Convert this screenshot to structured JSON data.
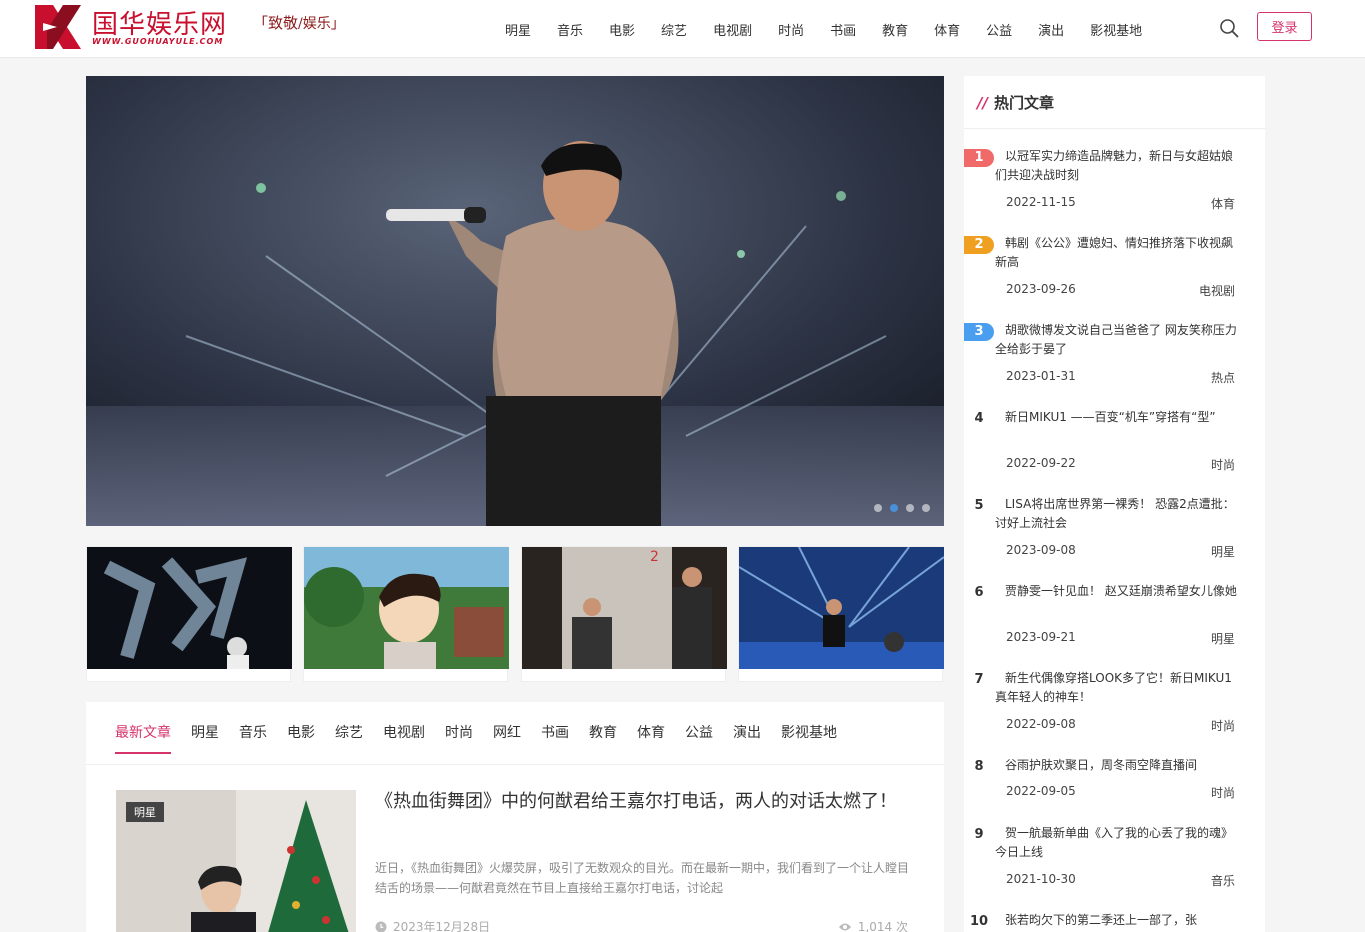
{
  "header": {
    "logo_cn": "国华娱乐网",
    "logo_en": "WWW.GUOHUAYULE.COM",
    "slogan_left": "「致敬",
    "slogan_right": "/娱乐」",
    "nav": [
      "明星",
      "音乐",
      "电影",
      "综艺",
      "电视剧",
      "时尚",
      "书画",
      "教育",
      "体育",
      "公益",
      "演出",
      "影视基地"
    ],
    "login_label": "登录",
    "brand_color": "#c8102e",
    "accent_color": "#d6336c"
  },
  "hero": {
    "dots_count": 4,
    "active_dot": 2
  },
  "latest": {
    "tabs": [
      "最新文章",
      "明星",
      "音乐",
      "电影",
      "综艺",
      "电视剧",
      "时尚",
      "网红",
      "书画",
      "教育",
      "体育",
      "公益",
      "演出",
      "影视基地"
    ],
    "active_tab": 0,
    "article": {
      "tag": "明星",
      "title": "《热血街舞团》中的何猷君给王嘉尔打电话，两人的对话太燃了！",
      "summary": "近日，《热血街舞团》火爆荧屏，吸引了无数观众的目光。而在最新一期中，我们看到了一个让人瞠目结舌的场景——何猷君竟然在节目上直接给王嘉尔打电话，讨论起",
      "date": "2023年12月28日",
      "views": "1,014 次"
    }
  },
  "sidebar": {
    "title": "热门文章",
    "items": [
      {
        "rank": "1",
        "title": "以冠军实力缔造品牌魅力，新日与女超姑娘们共迎决战时刻",
        "date": "2022-11-15",
        "cat": "体育"
      },
      {
        "rank": "2",
        "title": "韩剧《公公》遭媳妇、情妇推挤落下收视飙新高",
        "date": "2023-09-26",
        "cat": "电视剧"
      },
      {
        "rank": "3",
        "title": "胡歌微博发文说自己当爸爸了 网友笑称压力全给彭于晏了",
        "date": "2023-01-31",
        "cat": "热点"
      },
      {
        "rank": "4",
        "title": "新日MIKU1 ——百变“机车”穿搭有“型”",
        "date": "2022-09-22",
        "cat": "时尚"
      },
      {
        "rank": "5",
        "title": "LISA将出席世界第一裸秀！ 恐露2点遭批：讨好上流社会",
        "date": "2023-09-08",
        "cat": "明星"
      },
      {
        "rank": "6",
        "title": "贾静雯一针见血！ 赵又廷崩溃希望女儿像她",
        "date": "2023-09-21",
        "cat": "明星"
      },
      {
        "rank": "7",
        "title": "新生代偶像穿搭LOOK多了它！新日MIKU1真年轻人的神车！",
        "date": "2022-09-08",
        "cat": "时尚"
      },
      {
        "rank": "8",
        "title": "谷雨护肤欢聚日，周冬雨空降直播间",
        "date": "2022-09-05",
        "cat": "时尚"
      },
      {
        "rank": "9",
        "title": "贺一航最新单曲《入了我的心丢了我的魂》今日上线",
        "date": "2021-10-30",
        "cat": "音乐"
      },
      {
        "rank": "10",
        "title": "张若昀欠下的第二季还上一部了，张",
        "date": "",
        "cat": ""
      }
    ]
  }
}
